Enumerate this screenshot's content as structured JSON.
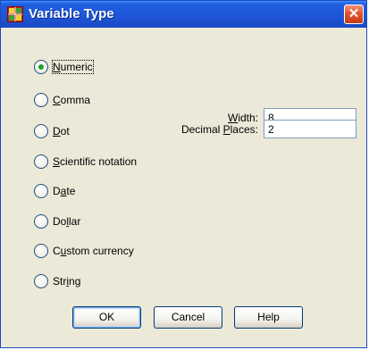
{
  "window": {
    "title": "Variable Type",
    "close_glyph": "✕"
  },
  "radio_options": [
    {
      "id": "numeric",
      "before": "",
      "mnemonic": "N",
      "after": "umeric",
      "selected": true
    },
    {
      "id": "comma",
      "before": "",
      "mnemonic": "C",
      "after": "omma",
      "selected": false
    },
    {
      "id": "dot",
      "before": "",
      "mnemonic": "D",
      "after": "ot",
      "selected": false
    },
    {
      "id": "scientific",
      "before": "",
      "mnemonic": "S",
      "after": "cientific notation",
      "selected": false
    },
    {
      "id": "date",
      "before": "D",
      "mnemonic": "a",
      "after": "te",
      "selected": false
    },
    {
      "id": "dollar",
      "before": "Do",
      "mnemonic": "l",
      "after": "lar",
      "selected": false
    },
    {
      "id": "custom",
      "before": "C",
      "mnemonic": "u",
      "after": "stom currency",
      "selected": false
    },
    {
      "id": "string",
      "before": "Str",
      "mnemonic": "i",
      "after": "ng",
      "selected": false
    }
  ],
  "fields": {
    "width": {
      "before": "",
      "mnemonic": "W",
      "after": "idth:",
      "value": "8"
    },
    "decimal": {
      "before": "Decimal ",
      "mnemonic": "P",
      "after": "laces:",
      "value": "2"
    }
  },
  "buttons": {
    "ok": "OK",
    "cancel": "Cancel",
    "help": "Help"
  },
  "colors": {
    "title_bar": "#1d55d6",
    "selected_dot": "#21a121",
    "close_button": "#e0552e"
  }
}
